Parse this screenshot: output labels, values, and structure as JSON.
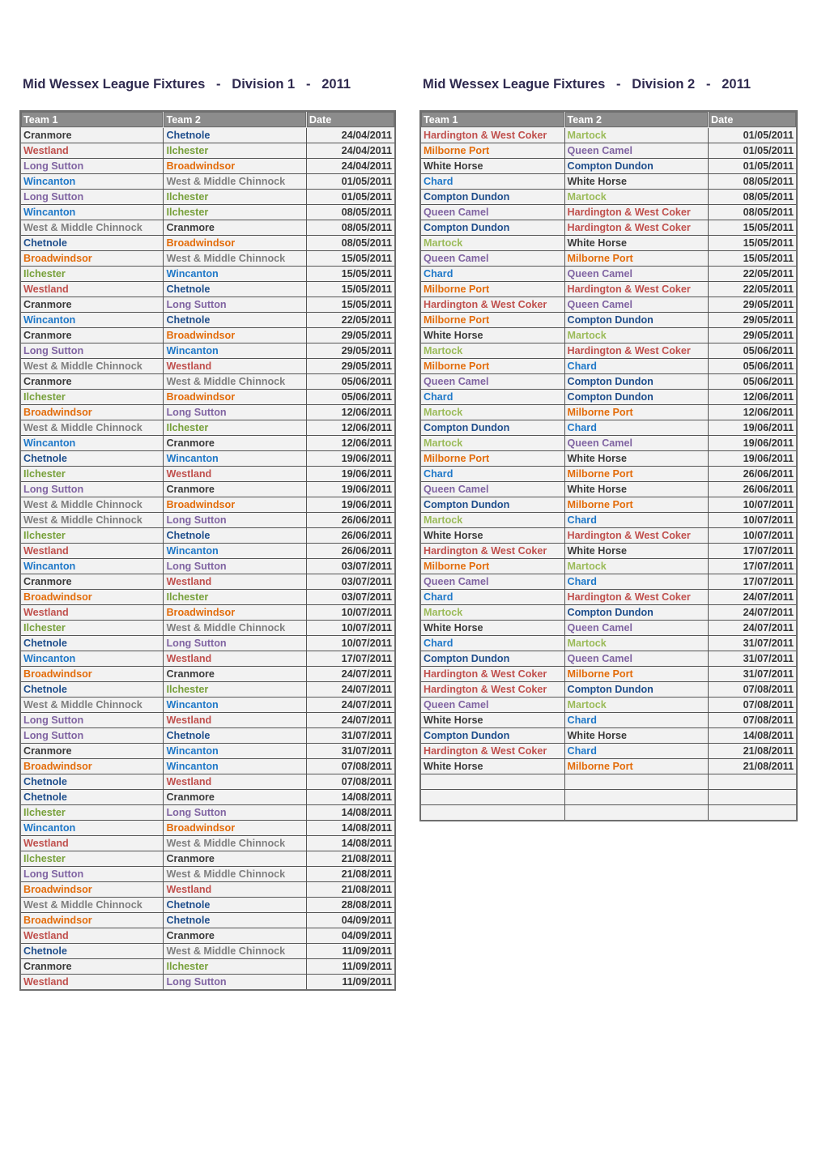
{
  "colors": {
    "Cranmore": "#3a3a3a",
    "Chetnole": "#1f4e8c",
    "Westland": "#c0504d",
    "Ilchester": "#77a03a",
    "Long Sutton": "#8064a2",
    "Broadwindsor": "#e36c0a",
    "Wincanton": "#1f78c8",
    "West & Middle Chinnock": "#7f7f7f",
    "Hardington & West Coker": "#c0504d",
    "Martock": "#9bbb59",
    "Milborne Port": "#e36c0a",
    "Queen Camel": "#8064a2",
    "White Horse": "#3a3a3a",
    "Compton Dundon": "#1f4e8c",
    "Chard": "#1f78c8"
  },
  "division1": {
    "title": "Mid Wessex League Fixtures   -   Division 1   -   2011",
    "headers": [
      "Team 1",
      "Team 2",
      "Date"
    ],
    "rows": [
      [
        "Cranmore",
        "Chetnole",
        "24/04/2011"
      ],
      [
        "Westland",
        "Ilchester",
        "24/04/2011"
      ],
      [
        "Long Sutton",
        "Broadwindsor",
        "24/04/2011"
      ],
      [
        "Wincanton",
        "West & Middle Chinnock",
        "01/05/2011"
      ],
      [
        "Long Sutton",
        "Ilchester",
        "01/05/2011"
      ],
      [
        "Wincanton",
        "Ilchester",
        "08/05/2011"
      ],
      [
        "West & Middle Chinnock",
        "Cranmore",
        "08/05/2011"
      ],
      [
        "Chetnole",
        "Broadwindsor",
        "08/05/2011"
      ],
      [
        "Broadwindsor",
        "West & Middle Chinnock",
        "15/05/2011"
      ],
      [
        "Ilchester",
        "Wincanton",
        "15/05/2011"
      ],
      [
        "Westland",
        "Chetnole",
        "15/05/2011"
      ],
      [
        "Cranmore",
        "Long Sutton",
        "15/05/2011"
      ],
      [
        "Wincanton",
        "Chetnole",
        "22/05/2011"
      ],
      [
        "Cranmore",
        "Broadwindsor",
        "29/05/2011"
      ],
      [
        "Long Sutton",
        "Wincanton",
        "29/05/2011"
      ],
      [
        "West & Middle Chinnock",
        "Westland",
        "29/05/2011"
      ],
      [
        "Cranmore",
        "West & Middle Chinnock",
        "05/06/2011"
      ],
      [
        "Ilchester",
        "Broadwindsor",
        "05/06/2011"
      ],
      [
        "Broadwindsor",
        "Long Sutton",
        "12/06/2011"
      ],
      [
        "West & Middle Chinnock",
        "Ilchester",
        "12/06/2011"
      ],
      [
        "Wincanton",
        "Cranmore",
        "12/06/2011"
      ],
      [
        "Chetnole",
        "Wincanton",
        "19/06/2011"
      ],
      [
        "Ilchester",
        "Westland",
        "19/06/2011"
      ],
      [
        "Long Sutton",
        "Cranmore",
        "19/06/2011"
      ],
      [
        "West & Middle Chinnock",
        "Broadwindsor",
        "19/06/2011"
      ],
      [
        "West & Middle Chinnock",
        "Long Sutton",
        "26/06/2011"
      ],
      [
        "Ilchester",
        "Chetnole",
        "26/06/2011"
      ],
      [
        "Westland",
        "Wincanton",
        "26/06/2011"
      ],
      [
        "Wincanton",
        "Long Sutton",
        "03/07/2011"
      ],
      [
        "Cranmore",
        "Westland",
        "03/07/2011"
      ],
      [
        "Broadwindsor",
        "Ilchester",
        "03/07/2011"
      ],
      [
        "Westland",
        "Broadwindsor",
        "10/07/2011"
      ],
      [
        "Ilchester",
        "West & Middle Chinnock",
        "10/07/2011"
      ],
      [
        "Chetnole",
        "Long Sutton",
        "10/07/2011"
      ],
      [
        "Wincanton",
        "Westland",
        "17/07/2011"
      ],
      [
        "Broadwindsor",
        "Cranmore",
        "24/07/2011"
      ],
      [
        "Chetnole",
        "Ilchester",
        "24/07/2011"
      ],
      [
        "West & Middle Chinnock",
        "Wincanton",
        "24/07/2011"
      ],
      [
        "Long Sutton",
        "Westland",
        "24/07/2011"
      ],
      [
        "Long Sutton",
        "Chetnole",
        "31/07/2011"
      ],
      [
        "Cranmore",
        "Wincanton",
        "31/07/2011"
      ],
      [
        "Broadwindsor",
        "Wincanton",
        "07/08/2011"
      ],
      [
        "Chetnole",
        "Westland",
        "07/08/2011"
      ],
      [
        "Chetnole",
        "Cranmore",
        "14/08/2011"
      ],
      [
        "Ilchester",
        "Long Sutton",
        "14/08/2011"
      ],
      [
        "Wincanton",
        "Broadwindsor",
        "14/08/2011"
      ],
      [
        "Westland",
        "West & Middle Chinnock",
        "14/08/2011"
      ],
      [
        "Ilchester",
        "Cranmore",
        "21/08/2011"
      ],
      [
        "Long Sutton",
        "West & Middle Chinnock",
        "21/08/2011"
      ],
      [
        "Broadwindsor",
        "Westland",
        "21/08/2011"
      ],
      [
        "West & Middle Chinnock",
        "Chetnole",
        "28/08/2011"
      ],
      [
        "Broadwindsor",
        "Chetnole",
        "04/09/2011"
      ],
      [
        "Westland",
        "Cranmore",
        "04/09/2011"
      ],
      [
        "Chetnole",
        "West & Middle Chinnock",
        "11/09/2011"
      ],
      [
        "Cranmore",
        "Ilchester",
        "11/09/2011"
      ],
      [
        "Westland",
        "Long Sutton",
        "11/09/2011"
      ]
    ]
  },
  "division2": {
    "title": "Mid Wessex League Fixtures   -   Division 2   -   2011",
    "headers": [
      "Team 1",
      "Team 2",
      "Date"
    ],
    "rows": [
      [
        "Hardington & West Coker",
        "Martock",
        "01/05/2011"
      ],
      [
        "Milborne Port",
        "Queen Camel",
        "01/05/2011"
      ],
      [
        "White Horse",
        "Compton Dundon",
        "01/05/2011"
      ],
      [
        "Chard",
        "White Horse",
        "08/05/2011"
      ],
      [
        "Compton Dundon",
        "Martock",
        "08/05/2011"
      ],
      [
        "Queen Camel",
        "Hardington & West Coker",
        "08/05/2011"
      ],
      [
        "Compton Dundon",
        "Hardington & West Coker",
        "15/05/2011"
      ],
      [
        "Martock",
        "White Horse",
        "15/05/2011"
      ],
      [
        "Queen Camel",
        "Milborne Port",
        "15/05/2011"
      ],
      [
        "Chard",
        "Queen Camel",
        "22/05/2011"
      ],
      [
        "Milborne Port",
        "Hardington & West Coker",
        "22/05/2011"
      ],
      [
        "Hardington & West Coker",
        "Queen Camel",
        "29/05/2011"
      ],
      [
        "Milborne Port",
        "Compton Dundon",
        "29/05/2011"
      ],
      [
        "White Horse",
        "Martock",
        "29/05/2011"
      ],
      [
        "Martock",
        "Hardington & West Coker",
        "05/06/2011"
      ],
      [
        "Milborne Port",
        "Chard",
        "05/06/2011"
      ],
      [
        "Queen Camel",
        "Compton Dundon",
        "05/06/2011"
      ],
      [
        "Chard",
        "Compton Dundon",
        "12/06/2011"
      ],
      [
        "Martock",
        "Milborne Port",
        "12/06/2011"
      ],
      [
        "Compton Dundon",
        "Chard",
        "19/06/2011"
      ],
      [
        "Martock",
        "Queen Camel",
        "19/06/2011"
      ],
      [
        "Milborne Port",
        "White Horse",
        "19/06/2011"
      ],
      [
        "Chard",
        "Milborne Port",
        "26/06/2011"
      ],
      [
        "Queen Camel",
        "White Horse",
        "26/06/2011"
      ],
      [
        "Compton Dundon",
        "Milborne Port",
        "10/07/2011"
      ],
      [
        "Martock",
        "Chard",
        "10/07/2011"
      ],
      [
        "White Horse",
        "Hardington & West Coker",
        "10/07/2011"
      ],
      [
        "Hardington & West Coker",
        "White Horse",
        "17/07/2011"
      ],
      [
        "Milborne Port",
        "Martock",
        "17/07/2011"
      ],
      [
        "Queen Camel",
        "Chard",
        "17/07/2011"
      ],
      [
        "Chard",
        "Hardington & West Coker",
        "24/07/2011"
      ],
      [
        "Martock",
        "Compton Dundon",
        "24/07/2011"
      ],
      [
        "White Horse",
        "Queen Camel",
        "24/07/2011"
      ],
      [
        "Chard",
        "Martock",
        "31/07/2011"
      ],
      [
        "Compton Dundon",
        "Queen Camel",
        "31/07/2011"
      ],
      [
        "Hardington & West Coker",
        "Milborne Port",
        "31/07/2011"
      ],
      [
        "Hardington & West Coker",
        "Compton Dundon",
        "07/08/2011"
      ],
      [
        "Queen Camel",
        "Martock",
        "07/08/2011"
      ],
      [
        "White Horse",
        "Chard",
        "07/08/2011"
      ],
      [
        "Compton Dundon",
        "White Horse",
        "14/08/2011"
      ],
      [
        "Hardington & West Coker",
        "Chard",
        "21/08/2011"
      ],
      [
        "White Horse",
        "Milborne Port",
        "21/08/2011"
      ],
      [
        "",
        "",
        ""
      ],
      [
        "",
        "",
        ""
      ],
      [
        "",
        "",
        ""
      ]
    ]
  }
}
